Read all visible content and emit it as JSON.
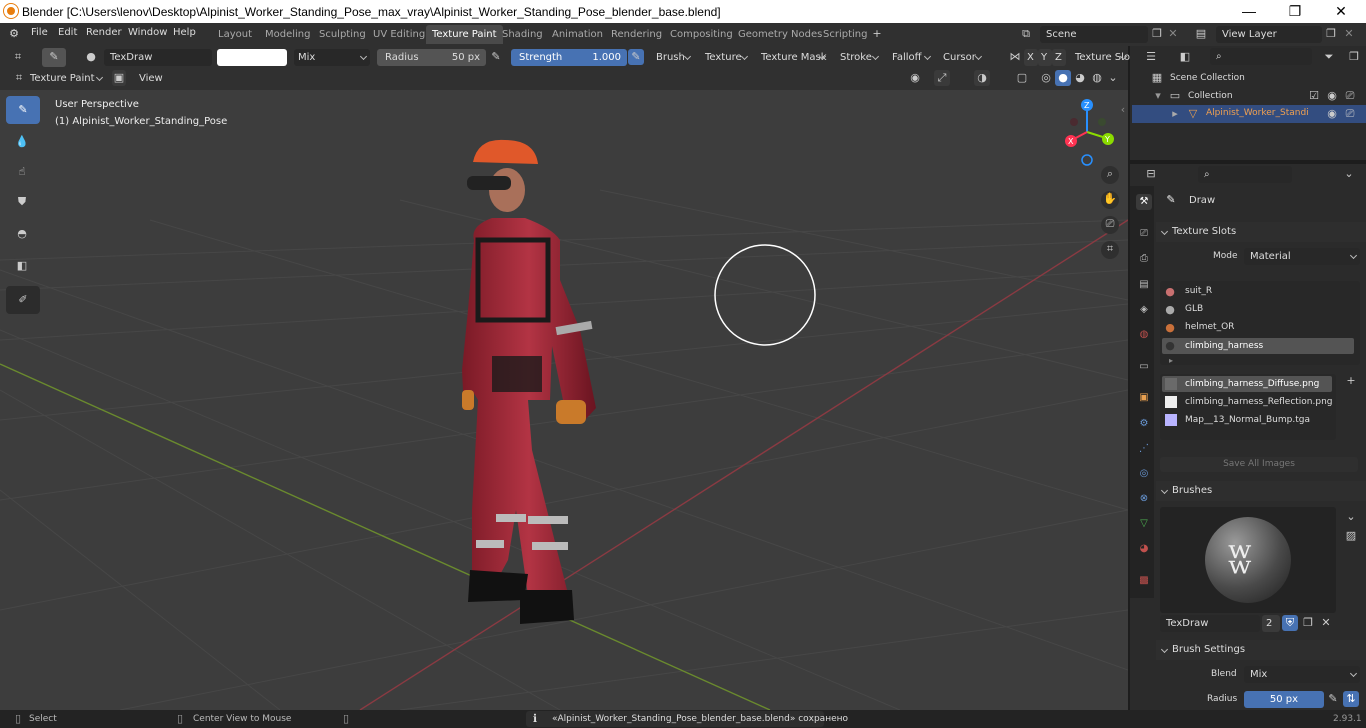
{
  "window": {
    "title": "Blender [C:\\Users\\lenov\\Desktop\\Alpinist_Worker_Standing_Pose_max_vray\\Alpinist_Worker_Standing_Pose_blender_base.blend]",
    "minimize": "—",
    "maximize": "❐",
    "close": "✕"
  },
  "menus": [
    "File",
    "Edit",
    "Render",
    "Window",
    "Help"
  ],
  "workspaces": [
    "Layout",
    "Modeling",
    "Sculpting",
    "UV Editing",
    "Texture Paint",
    "Shading",
    "Animation",
    "Rendering",
    "Compositing",
    "Geometry Nodes",
    "Scripting"
  ],
  "active_workspace_index": 4,
  "scene": {
    "name": "Scene",
    "view_layer": "View Layer"
  },
  "toolheader": {
    "brush_name": "TexDraw",
    "blend": "Mix",
    "radius_label": "Radius",
    "radius_value": "50 px",
    "strength_label": "Strength",
    "strength_value": "1.000",
    "menus": [
      "Brush",
      "Texture",
      "Texture Mask",
      "Stroke",
      "Falloff",
      "Cursor"
    ],
    "axes": [
      "X",
      "Y",
      "Z"
    ],
    "texture_slots": "Texture Slots"
  },
  "modeheader": {
    "mode": "Texture Paint",
    "view": "View"
  },
  "viewport": {
    "perspective": "User Perspective",
    "object": "(1) Alpinist_Worker_Standing_Pose",
    "gizmo": {
      "z": "Z",
      "y": "Y",
      "x": "X"
    }
  },
  "outliner": {
    "scene_collection": "Scene Collection",
    "collection": "Collection",
    "object": "Alpinist_Worker_Standing"
  },
  "properties": {
    "tool_name": "Draw",
    "texture_slots_title": "Texture Slots",
    "mode_label": "Mode",
    "mode_value": "Material",
    "materials": [
      "suit_R",
      "GLB",
      "helmet_OR",
      "climbing_harness"
    ],
    "active_material_index": 3,
    "images": [
      "climbing_harness_Diffuse.png",
      "climbing_harness_Reflection.png",
      "Map__13_Normal_Bump.tga"
    ],
    "active_image_index": 0,
    "save_all": "Save All Images",
    "brushes_title": "Brushes",
    "brush_name": "TexDraw",
    "brush_users": "2",
    "brush_settings_title": "Brush Settings",
    "blend_label": "Blend",
    "blend_value": "Mix",
    "radius_label": "Radius",
    "radius_value": "50 px"
  },
  "status": {
    "select": "Select",
    "center": "Center View to Mouse",
    "message": "«Alpinist_Worker_Standing_Pose_blender_base.blend» сохранено",
    "version": "2.93.1"
  },
  "colors": {
    "accent": "#4772b3",
    "x_axis": "#ff3352",
    "y_axis": "#8bdc00",
    "z_axis": "#2890ff",
    "active_ws": "#4a4a4a"
  }
}
